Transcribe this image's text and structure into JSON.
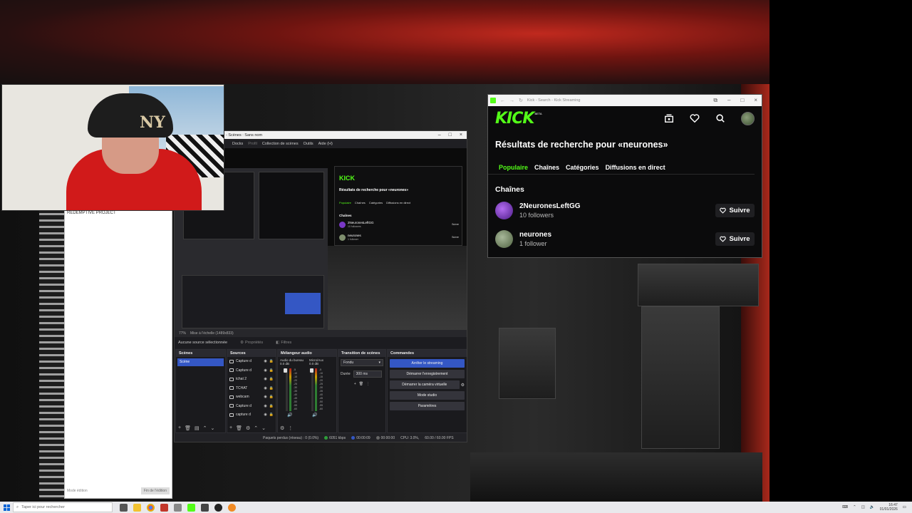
{
  "obs": {
    "window_title": "- Scènes : Sans nom",
    "menu": [
      "Docks",
      "Profil",
      "Collection de scènes",
      "Outils",
      "Aide (H)"
    ],
    "zoom_label": "Mise à l'échelle (1489x833)",
    "zoom_pct": "77%",
    "no_source": "Aucune source sélectionnée",
    "properties_btn": "Propriétés",
    "filters_btn": "Filtres",
    "docks": {
      "scenes_title": "Scènes",
      "scenes": [
        "Scène"
      ],
      "sources_title": "Sources",
      "sources": [
        "Capture d",
        "Capture d",
        "tchat 2",
        "TCHAT",
        "webcam",
        "Capture d",
        "capture d"
      ],
      "mixer_title": "Mélangeur audio",
      "mixer_channels": [
        {
          "name": "Audio du bureau",
          "level": "0.0 dB"
        },
        {
          "name": "Micro/Aux",
          "level": "0.0 dB"
        }
      ],
      "mixer_scale": [
        "-5",
        "-10",
        "-15",
        "-20",
        "-25",
        "-30",
        "-35",
        "-40",
        "-45",
        "-50",
        "-55",
        "-60"
      ],
      "transitions_title": "Transition de scènes",
      "transition_value": "Fondu",
      "duration_label": "Durée",
      "duration_value": "300 ms",
      "controls_title": "Commandes",
      "controls": [
        "Arrêter le streaming",
        "Démarrer l'enregistrement",
        "Démarrer la caméra virtuelle",
        "Mode studio",
        "Paramètres"
      ]
    },
    "status": {
      "dropped": "Paquets perdus (réseau) : 0 (0.0%)",
      "bitrate": "6051 kbps",
      "live_time": "00:00:09",
      "rec_time": "00:00:00",
      "cpu": "CPU: 3.0%,",
      "fps": "60.00 / 60.00 FPS"
    }
  },
  "chat": {
    "header": "REDEMPTIVE PROJECT",
    "footer_left": "Mode édition",
    "footer_btn": "Fin de l'édition"
  },
  "kick": {
    "tab_title": "Kick - Search - Kick Streaming",
    "logo": "KICK",
    "beta": "BETA",
    "heading": "Résultats de recherche pour «neurones»",
    "tabs": [
      "Populaire",
      "Chaînes",
      "Catégories",
      "Diffusions en direct"
    ],
    "section": "Chaînes",
    "results": [
      {
        "name": "2NeuronesLeftGG",
        "followers": "10 followers",
        "button": "Suivre",
        "avatar_color": "#7a38c6"
      },
      {
        "name": "neurones",
        "followers": "1 follower",
        "button": "Suivre",
        "avatar_color": "#7f8f6e"
      }
    ]
  },
  "preview_kick": {
    "logo": "KICK",
    "heading": "Résultats de recherche pour «neurones»",
    "tabs": [
      "Populaire",
      "Chaînes",
      "Catégories",
      "Diffusions en direct"
    ],
    "section": "Chaînes",
    "results": [
      {
        "name": "2NeuronesLeftGG",
        "followers": "10 followers",
        "button": "Suivre"
      },
      {
        "name": "neurones",
        "followers": "1 follower",
        "button": "Suivre"
      }
    ]
  },
  "webcam": {
    "cap_logo": "NY"
  },
  "taskbar": {
    "search_placeholder": "Taper ici pour rechercher",
    "time": "16:47",
    "date": "01/01/2026"
  },
  "colors": {
    "kick_green": "#53fc18",
    "obs_blue": "#3457c4"
  }
}
